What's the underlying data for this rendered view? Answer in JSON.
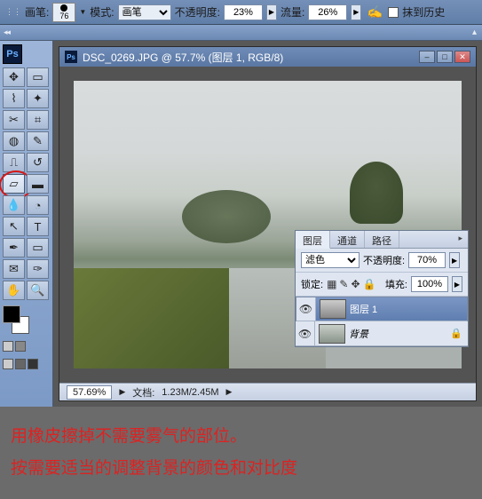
{
  "optbar": {
    "brush_label": "画笔:",
    "brush_size": "76",
    "mode_label": "模式:",
    "mode_value": "画笔",
    "opacity_label": "不透明度:",
    "opacity_value": "23%",
    "flow_label": "流量:",
    "flow_value": "26%",
    "history_label": "抹到历史"
  },
  "toolbox": {
    "logo": "Ps"
  },
  "document": {
    "title": "DSC_0269.JPG @ 57.7% (图层 1, RGB/8)",
    "zoom": "57.69%",
    "docinfo_label": "文档:",
    "docinfo": "1.23M/2.45M"
  },
  "layers": {
    "tabs": [
      "图层",
      "通道",
      "路径"
    ],
    "blend_value": "滤色",
    "opacity_label": "不透明度:",
    "opacity_value": "70%",
    "lock_label": "锁定:",
    "fill_label": "填充:",
    "fill_value": "100%",
    "items": [
      {
        "name": "图层 1"
      },
      {
        "name": "背景"
      }
    ]
  },
  "caption": {
    "line1": "用橡皮擦掉不需要雾气的部位。",
    "line2": "按需要适当的调整背景的颜色和对比度"
  }
}
